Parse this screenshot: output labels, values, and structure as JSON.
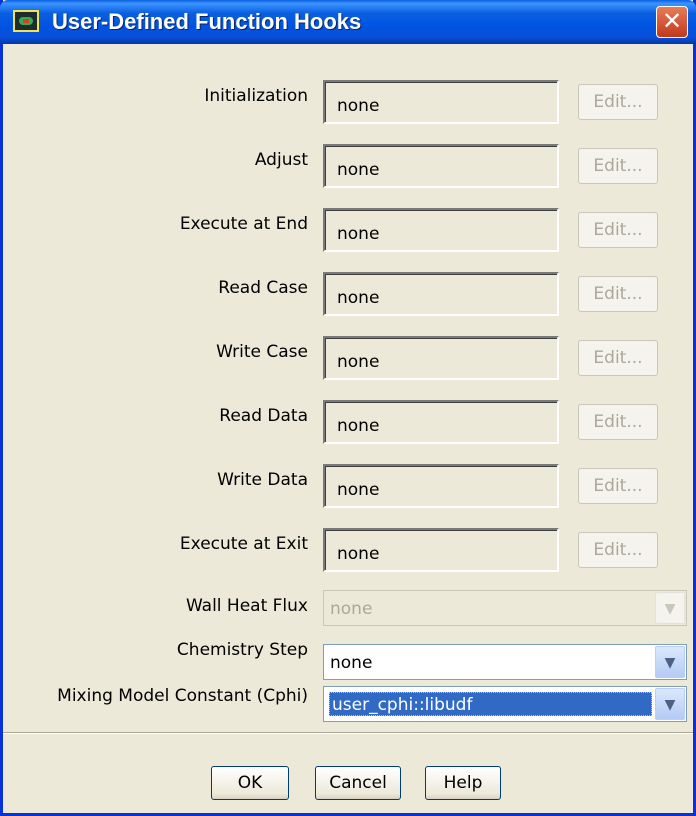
{
  "window": {
    "title": "User-Defined Function Hooks",
    "close_glyph": "✕"
  },
  "hooks": [
    {
      "label": "Initialization",
      "value": "none",
      "edit_label": "Edit..."
    },
    {
      "label": "Adjust",
      "value": "none",
      "edit_label": "Edit..."
    },
    {
      "label": "Execute at End",
      "value": "none",
      "edit_label": "Edit..."
    },
    {
      "label": "Read Case",
      "value": "none",
      "edit_label": "Edit..."
    },
    {
      "label": "Write Case",
      "value": "none",
      "edit_label": "Edit..."
    },
    {
      "label": "Read Data",
      "value": "none",
      "edit_label": "Edit..."
    },
    {
      "label": "Write Data",
      "value": "none",
      "edit_label": "Edit..."
    },
    {
      "label": "Execute at Exit",
      "value": "none",
      "edit_label": "Edit..."
    }
  ],
  "dropdowns": {
    "wall_heat_flux": {
      "label": "Wall Heat Flux",
      "value": "none",
      "enabled": false
    },
    "chemistry_step": {
      "label": "Chemistry Step",
      "value": "none",
      "enabled": true
    },
    "mixing_model_constant": {
      "label": "Mixing Model Constant (Cphi)",
      "value": "user_cphi::libudf",
      "enabled": true
    }
  },
  "buttons": {
    "ok": "OK",
    "cancel": "Cancel",
    "help": "Help"
  },
  "icons": {
    "app": "fluent-app-icon",
    "close": "close-icon",
    "dropdown": "chevron-down-icon"
  },
  "colors": {
    "titlebar": "#0a5fe0",
    "dialog_bg": "#ece9d8",
    "selection": "#316ac5",
    "disabled_text": "#aca899"
  }
}
